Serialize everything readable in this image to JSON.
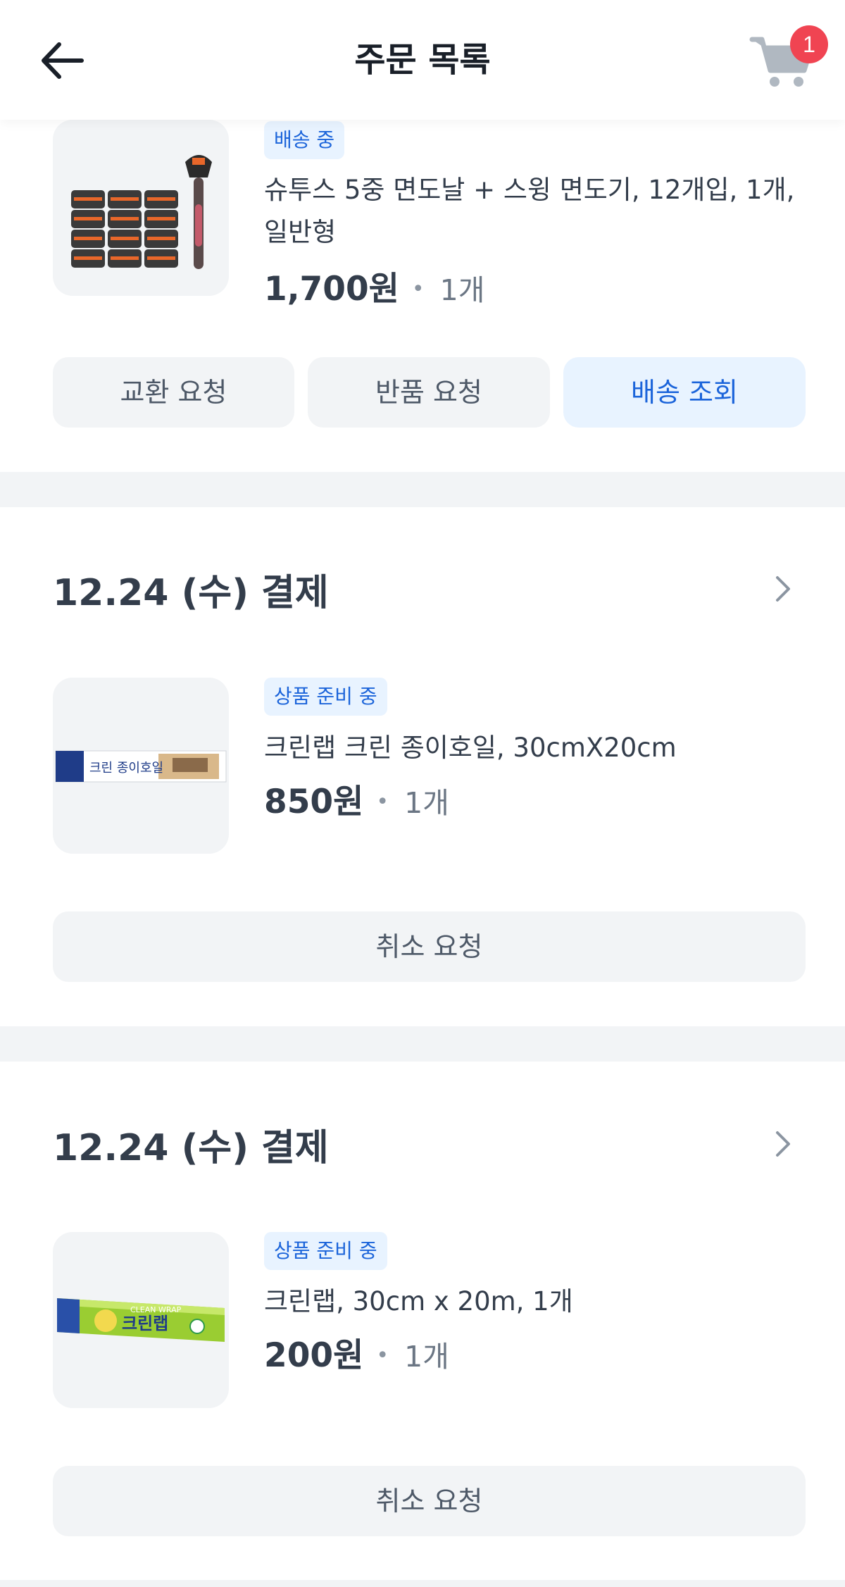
{
  "header": {
    "title": "주문 목록",
    "back_icon": "back-arrow-icon",
    "cart_icon": "cart-icon",
    "cart_count": "1"
  },
  "orders": [
    {
      "date": "",
      "items": [
        {
          "status": "배송 중",
          "name": "슈투스 5중 면도날 + 스윙 면도기, 12개입, 1개, 일반형",
          "price": "1,700원",
          "quantity": "1개"
        }
      ],
      "actions": [
        "교환 요청",
        "반품 요청",
        "배송 조회"
      ]
    },
    {
      "date": "12.24 (수) 결제",
      "items": [
        {
          "status": "상품 준비 중",
          "name": "크린랩 크린 종이호일, 30cmX20cm",
          "price": "850원",
          "quantity": "1개"
        }
      ],
      "actions": [
        "취소 요청"
      ]
    },
    {
      "date": "12.24 (수) 결제",
      "items": [
        {
          "status": "상품 준비 중",
          "name": "크린랩, 30cm x 20m, 1개",
          "price": "200원",
          "quantity": "1개"
        }
      ],
      "actions": [
        "취소 요청"
      ]
    }
  ],
  "product_images": {
    "box1": "크린 종이호일",
    "box2": "크린랩",
    "box2_sub": "CLEAN WRAP"
  },
  "colors": {
    "accent": "#1b64da",
    "accent_bg": "#e8f3ff",
    "badge_red": "#f04452",
    "button_bg": "#f2f4f6"
  }
}
